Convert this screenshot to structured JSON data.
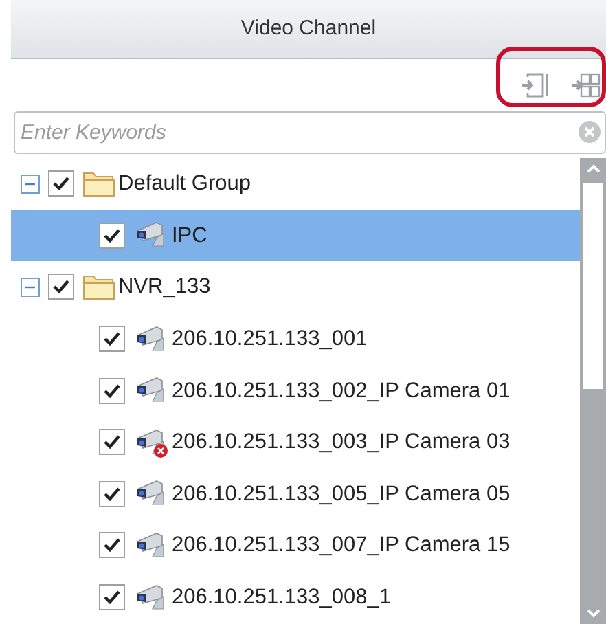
{
  "panel": {
    "title": "Video Channel"
  },
  "search": {
    "placeholder": "Enter Keywords"
  },
  "tree": [
    {
      "kind": "group",
      "label": "Default Group",
      "expanded": true,
      "checked": true,
      "selected": false,
      "children": [
        {
          "kind": "camera",
          "label": "IPC",
          "checked": true,
          "selected": true,
          "offline": false
        }
      ]
    },
    {
      "kind": "group",
      "label": "NVR_133",
      "expanded": true,
      "checked": true,
      "selected": false,
      "children": [
        {
          "kind": "camera",
          "label": "206.10.251.133_001",
          "checked": true,
          "selected": false,
          "offline": false
        },
        {
          "kind": "camera",
          "label": "206.10.251.133_002_IP Camera 01",
          "checked": true,
          "selected": false,
          "offline": false
        },
        {
          "kind": "camera",
          "label": "206.10.251.133_003_IP Camera 03",
          "checked": true,
          "selected": false,
          "offline": true
        },
        {
          "kind": "camera",
          "label": "206.10.251.133_005_IP Camera 05",
          "checked": true,
          "selected": false,
          "offline": false
        },
        {
          "kind": "camera",
          "label": "206.10.251.133_007_IP Camera 15",
          "checked": true,
          "selected": false,
          "offline": false
        },
        {
          "kind": "camera",
          "label": "206.10.251.133_008_1",
          "checked": true,
          "selected": false,
          "offline": false
        }
      ]
    }
  ]
}
